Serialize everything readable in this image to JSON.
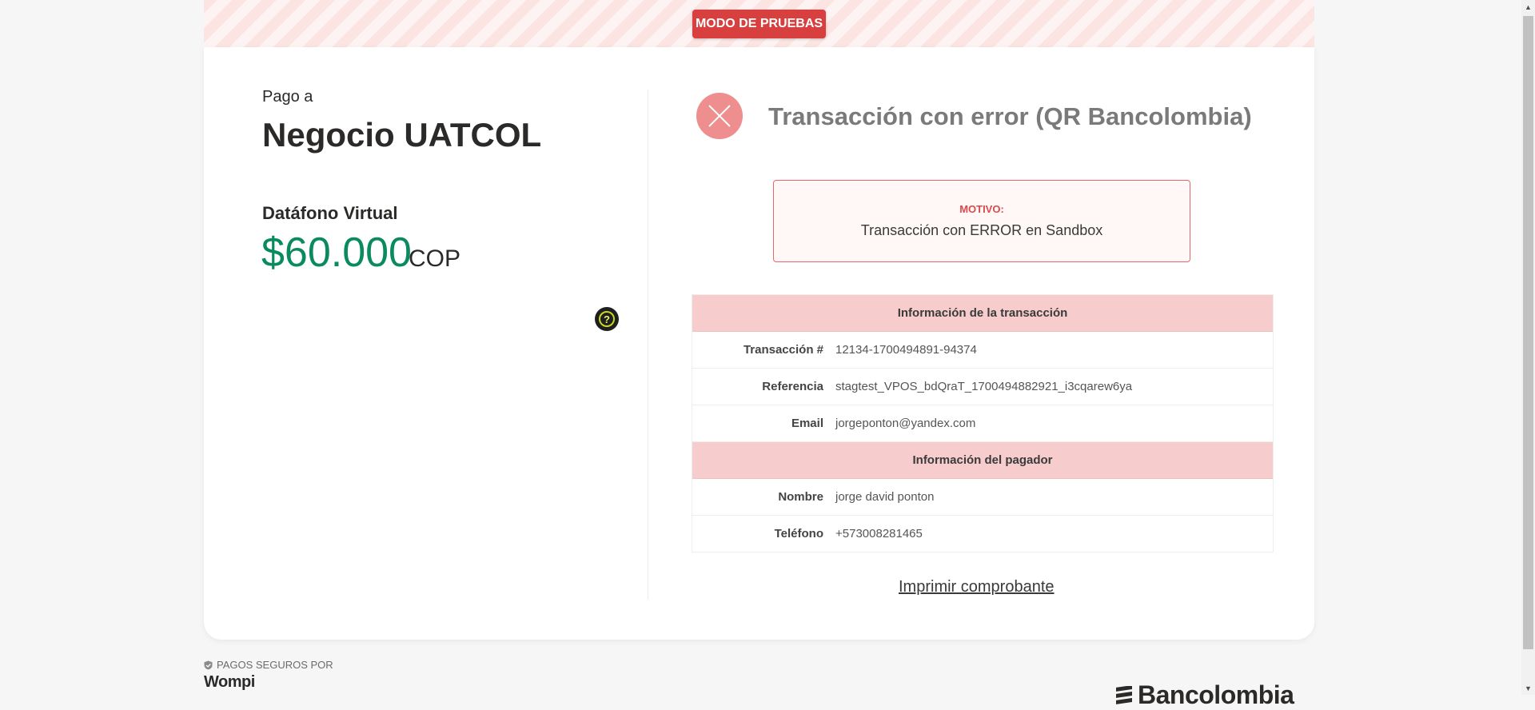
{
  "banner": {
    "test_mode": "MODO DE PRUEBAS"
  },
  "merchant": {
    "pay_to_label": "Pago a",
    "name": "Negocio UATCOL",
    "product": "Datáfono Virtual",
    "amount": "$60.000",
    "currency": "COP"
  },
  "help_icon": {
    "symbol": "?"
  },
  "status": {
    "icon": "x-circle-icon",
    "title": "Transacción con error (QR Bancolombia)",
    "reason_label": "MOTIVO:",
    "reason_text": "Transacción con ERROR en Sandbox"
  },
  "transaction_info": {
    "header": "Información de la transacción",
    "rows": [
      {
        "label": "Transacción #",
        "value": "12134-1700494891-94374"
      },
      {
        "label": "Referencia",
        "value": "stagtest_VPOS_bdQraT_1700494882921_i3cqarew6ya"
      },
      {
        "label": "Email",
        "value": "jorgeponton@yandex.com"
      }
    ]
  },
  "payer_info": {
    "header": "Información del pagador",
    "rows": [
      {
        "label": "Nombre",
        "value": "jorge david ponton"
      },
      {
        "label": "Teléfono",
        "value": "+573008281465"
      }
    ]
  },
  "print_link": "Imprimir comprobante",
  "footer": {
    "secure_label": "PAGOS SEGUROS POR",
    "secure_brand": "Wompi",
    "partner_brand": "Bancolombia"
  },
  "colors": {
    "accent_green": "#0a8a5f",
    "error_red": "#d83f3f",
    "section_pink": "#f7cccd"
  }
}
